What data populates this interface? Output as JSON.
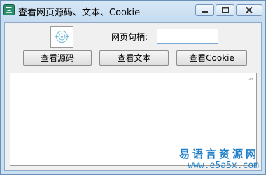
{
  "window": {
    "title": "查看网页源码、文本、Cookie"
  },
  "form": {
    "handle_label": "网页句柄:",
    "handle_value": "",
    "buttons": {
      "view_source": "查看源码",
      "view_text": "查看文本",
      "view_cookie": "查看Cookie"
    },
    "output_text": ""
  },
  "watermark": {
    "site_name": "易语言资源网",
    "url": "www.e5a5x.com"
  },
  "colors": {
    "titlebar": "#c9dff2",
    "watermark": "#1f7fc8"
  },
  "icons": {
    "app": "app-icon",
    "picture": "crosshair-target-icon",
    "minimize": "minimize-icon",
    "maximize": "maximize-icon",
    "close": "close-icon",
    "scroll_up": "scroll-up-arrow-icon"
  }
}
